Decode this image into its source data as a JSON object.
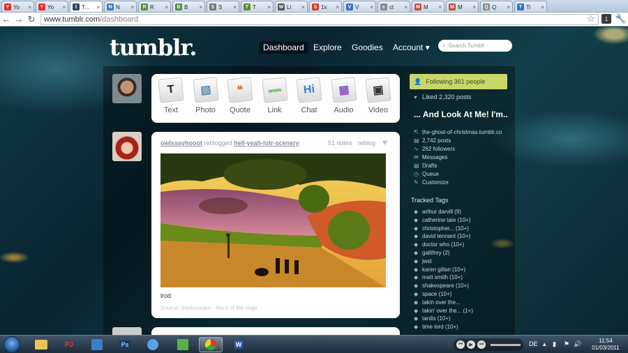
{
  "browser": {
    "tabs": [
      {
        "title": "Yo",
        "fav": "Y",
        "color": "#e52d27"
      },
      {
        "title": "Yo",
        "fav": "Y",
        "color": "#e52d27"
      },
      {
        "title": "T...",
        "fav": "t",
        "color": "#2c4762",
        "active": true
      },
      {
        "title": "N",
        "fav": "N",
        "color": "#3a7dc9"
      },
      {
        "title": "R",
        "fav": "R",
        "color": "#5a8a3a"
      },
      {
        "title": "B",
        "fav": "B",
        "color": "#5a8a3a"
      },
      {
        "title": "S",
        "fav": "S",
        "color": "#777"
      },
      {
        "title": "T",
        "fav": "T",
        "color": "#5a8a3a"
      },
      {
        "title": "Li",
        "fav": "W",
        "color": "#555"
      },
      {
        "title": "1x",
        "fav": "S",
        "color": "#d23a2a"
      },
      {
        "title": "V",
        "fav": "V",
        "color": "#3a6fc9"
      },
      {
        "title": "ct",
        "fav": "c",
        "color": "#888"
      },
      {
        "title": "M",
        "fav": "M",
        "color": "#c94a3a"
      },
      {
        "title": "M",
        "fav": "M",
        "color": "#c94a3a"
      },
      {
        "title": "Q",
        "fav": "Q",
        "color": "#888"
      },
      {
        "title": "Ti",
        "fav": "T",
        "color": "#3a6fc9"
      }
    ],
    "url_host": "www.tumblr.com",
    "url_path": "/dashboard",
    "ext_badge": "1"
  },
  "header": {
    "logo": "tumblr.",
    "nav": {
      "dashboard": "Dashboard",
      "explore": "Explore",
      "goodies": "Goodies",
      "account": "Account ▾"
    },
    "search_placeholder": "Search Tumblr"
  },
  "postbox": {
    "types": [
      {
        "label": "Text",
        "glyph": "T",
        "color": "#222"
      },
      {
        "label": "Photo",
        "glyph": "▧",
        "color": "#6a8caa"
      },
      {
        "label": "Quote",
        "glyph": "❝",
        "color": "#e87a2a"
      },
      {
        "label": "Link",
        "glyph": "www",
        "color": "#3aa03a"
      },
      {
        "label": "Chat",
        "glyph": "Hi",
        "color": "#3a7dc9"
      },
      {
        "label": "Audio",
        "glyph": "▦",
        "color": "#8a5ac9"
      },
      {
        "label": "Video",
        "glyph": "▣",
        "color": "#333"
      }
    ]
  },
  "post": {
    "user": "owlssayhooot",
    "action": "reblogged",
    "source_blog": "hell-yeah-lotr-scenery",
    "notes": "51 notes",
    "reblog": "reblog",
    "caption": "lrod",
    "source": "Source: thedunadan · #lord of the rings"
  },
  "sidebar": {
    "following": "Following 361 people",
    "liked": "Liked 2,320 posts",
    "blog_name": "... And Look At Me! I'm..",
    "blog_links": [
      {
        "label": "the-ghost-of-christmas.tumblr.co",
        "icon": "⇱"
      },
      {
        "label": "2,742 posts",
        "icon": "▤"
      },
      {
        "label": "262 followers",
        "icon": "∿"
      },
      {
        "label": "Messages",
        "icon": "✉"
      },
      {
        "label": "Drafts",
        "icon": "▤"
      },
      {
        "label": "Queue",
        "icon": "◷"
      },
      {
        "label": "Customize",
        "icon": "✎"
      }
    ],
    "tracked_title": "Tracked Tags",
    "tags": [
      "arthur darvill (9)",
      "catherine tate (10+)",
      "christopher... (10+)",
      "david tennant (10+)",
      "doctor who (10+)",
      "gallifrey (2)",
      "jwst",
      "karen gillan (10+)",
      "matt smith (10+)",
      "shakespeare (10+)",
      "space (10+)",
      "takin over the...",
      "takin' over the... (1+)",
      "tardis (10+)",
      "time lord (10+)"
    ]
  },
  "taskbar": {
    "lang": "DE",
    "time": "11:54",
    "date": "01/03/2011"
  },
  "colors": {
    "tumblr_blue": "#2c4762",
    "following_green": "#c8d66a"
  }
}
